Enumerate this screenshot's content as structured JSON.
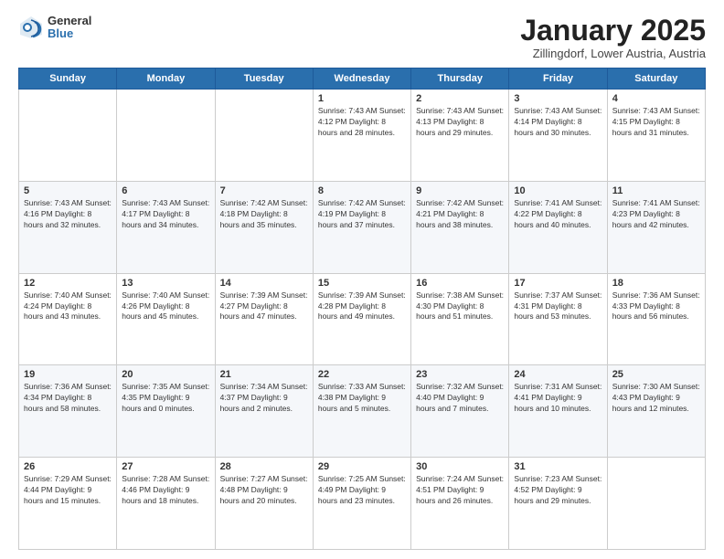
{
  "header": {
    "logo": {
      "general": "General",
      "blue": "Blue"
    },
    "title": "January 2025",
    "location": "Zillingdorf, Lower Austria, Austria"
  },
  "weekdays": [
    "Sunday",
    "Monday",
    "Tuesday",
    "Wednesday",
    "Thursday",
    "Friday",
    "Saturday"
  ],
  "weeks": [
    [
      {
        "day": "",
        "info": ""
      },
      {
        "day": "",
        "info": ""
      },
      {
        "day": "",
        "info": ""
      },
      {
        "day": "1",
        "info": "Sunrise: 7:43 AM\nSunset: 4:12 PM\nDaylight: 8 hours and 28 minutes."
      },
      {
        "day": "2",
        "info": "Sunrise: 7:43 AM\nSunset: 4:13 PM\nDaylight: 8 hours and 29 minutes."
      },
      {
        "day": "3",
        "info": "Sunrise: 7:43 AM\nSunset: 4:14 PM\nDaylight: 8 hours and 30 minutes."
      },
      {
        "day": "4",
        "info": "Sunrise: 7:43 AM\nSunset: 4:15 PM\nDaylight: 8 hours and 31 minutes."
      }
    ],
    [
      {
        "day": "5",
        "info": "Sunrise: 7:43 AM\nSunset: 4:16 PM\nDaylight: 8 hours and 32 minutes."
      },
      {
        "day": "6",
        "info": "Sunrise: 7:43 AM\nSunset: 4:17 PM\nDaylight: 8 hours and 34 minutes."
      },
      {
        "day": "7",
        "info": "Sunrise: 7:42 AM\nSunset: 4:18 PM\nDaylight: 8 hours and 35 minutes."
      },
      {
        "day": "8",
        "info": "Sunrise: 7:42 AM\nSunset: 4:19 PM\nDaylight: 8 hours and 37 minutes."
      },
      {
        "day": "9",
        "info": "Sunrise: 7:42 AM\nSunset: 4:21 PM\nDaylight: 8 hours and 38 minutes."
      },
      {
        "day": "10",
        "info": "Sunrise: 7:41 AM\nSunset: 4:22 PM\nDaylight: 8 hours and 40 minutes."
      },
      {
        "day": "11",
        "info": "Sunrise: 7:41 AM\nSunset: 4:23 PM\nDaylight: 8 hours and 42 minutes."
      }
    ],
    [
      {
        "day": "12",
        "info": "Sunrise: 7:40 AM\nSunset: 4:24 PM\nDaylight: 8 hours and 43 minutes."
      },
      {
        "day": "13",
        "info": "Sunrise: 7:40 AM\nSunset: 4:26 PM\nDaylight: 8 hours and 45 minutes."
      },
      {
        "day": "14",
        "info": "Sunrise: 7:39 AM\nSunset: 4:27 PM\nDaylight: 8 hours and 47 minutes."
      },
      {
        "day": "15",
        "info": "Sunrise: 7:39 AM\nSunset: 4:28 PM\nDaylight: 8 hours and 49 minutes."
      },
      {
        "day": "16",
        "info": "Sunrise: 7:38 AM\nSunset: 4:30 PM\nDaylight: 8 hours and 51 minutes."
      },
      {
        "day": "17",
        "info": "Sunrise: 7:37 AM\nSunset: 4:31 PM\nDaylight: 8 hours and 53 minutes."
      },
      {
        "day": "18",
        "info": "Sunrise: 7:36 AM\nSunset: 4:33 PM\nDaylight: 8 hours and 56 minutes."
      }
    ],
    [
      {
        "day": "19",
        "info": "Sunrise: 7:36 AM\nSunset: 4:34 PM\nDaylight: 8 hours and 58 minutes."
      },
      {
        "day": "20",
        "info": "Sunrise: 7:35 AM\nSunset: 4:35 PM\nDaylight: 9 hours and 0 minutes."
      },
      {
        "day": "21",
        "info": "Sunrise: 7:34 AM\nSunset: 4:37 PM\nDaylight: 9 hours and 2 minutes."
      },
      {
        "day": "22",
        "info": "Sunrise: 7:33 AM\nSunset: 4:38 PM\nDaylight: 9 hours and 5 minutes."
      },
      {
        "day": "23",
        "info": "Sunrise: 7:32 AM\nSunset: 4:40 PM\nDaylight: 9 hours and 7 minutes."
      },
      {
        "day": "24",
        "info": "Sunrise: 7:31 AM\nSunset: 4:41 PM\nDaylight: 9 hours and 10 minutes."
      },
      {
        "day": "25",
        "info": "Sunrise: 7:30 AM\nSunset: 4:43 PM\nDaylight: 9 hours and 12 minutes."
      }
    ],
    [
      {
        "day": "26",
        "info": "Sunrise: 7:29 AM\nSunset: 4:44 PM\nDaylight: 9 hours and 15 minutes."
      },
      {
        "day": "27",
        "info": "Sunrise: 7:28 AM\nSunset: 4:46 PM\nDaylight: 9 hours and 18 minutes."
      },
      {
        "day": "28",
        "info": "Sunrise: 7:27 AM\nSunset: 4:48 PM\nDaylight: 9 hours and 20 minutes."
      },
      {
        "day": "29",
        "info": "Sunrise: 7:25 AM\nSunset: 4:49 PM\nDaylight: 9 hours and 23 minutes."
      },
      {
        "day": "30",
        "info": "Sunrise: 7:24 AM\nSunset: 4:51 PM\nDaylight: 9 hours and 26 minutes."
      },
      {
        "day": "31",
        "info": "Sunrise: 7:23 AM\nSunset: 4:52 PM\nDaylight: 9 hours and 29 minutes."
      },
      {
        "day": "",
        "info": ""
      }
    ]
  ]
}
